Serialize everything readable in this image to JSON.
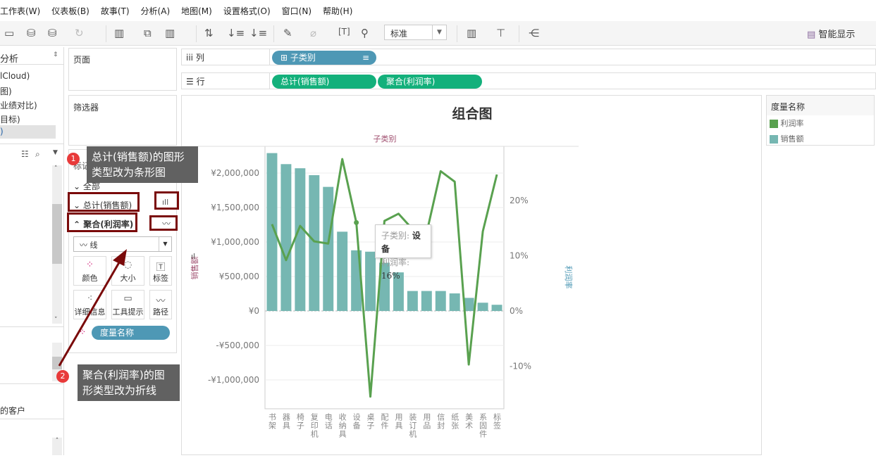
{
  "menu": [
    "工作表(W)",
    "仪表板(B)",
    "故事(T)",
    "分析(A)",
    "地图(M)",
    "设置格式(O)",
    "窗口(N)",
    "帮助(H)"
  ],
  "toolbar": {
    "fit_select": "标准",
    "smart_show": "智能显示"
  },
  "data_pane": {
    "title": "分析",
    "items": [
      "lCloud)",
      "图)",
      "业绩对比)",
      "目标)",
      ")"
    ],
    "set_item": "的客户"
  },
  "shelves": {
    "pages": "页面",
    "filters": "筛选器",
    "columns_label": "列",
    "rows_label": "行",
    "columns": [
      "子类别"
    ],
    "rows": [
      "总计(销售额)",
      "聚合(利润率)"
    ]
  },
  "marks": {
    "title": "标记",
    "all": "全部",
    "sum_sales": "总计(销售额)",
    "agg_profit": "聚合(利润率)",
    "mark_type": "线",
    "cards": [
      "颜色",
      "大小",
      "标签",
      "详细信息",
      "工具提示",
      "路径"
    ],
    "color_pill": "度量名称"
  },
  "legend": {
    "title": "度量名称",
    "items": [
      {
        "label": "利润率",
        "color": "#59a14f"
      },
      {
        "label": "销售额",
        "color": "#76b7b2"
      }
    ]
  },
  "tooltip": {
    "k1": "子类别:",
    "v1": "设备",
    "k2": "利润率:",
    "v2": "16%"
  },
  "annotations": {
    "n1": "1",
    "text1": "总计(销售额)的图形类型改为条形图",
    "n2": "2",
    "text2": "聚合(利润率)的图形类型改为折线"
  },
  "chart_data": {
    "type": "bar+line",
    "title": "组合图",
    "xlabel": "子类别",
    "ylabel": "销售额",
    "y2label": "利润率",
    "categories": [
      "书架",
      "器具",
      "椅子",
      "复印机",
      "电话",
      "收纳具",
      "设备",
      "桌子",
      "配件",
      "用具",
      "装订机",
      "用品",
      "信封",
      "纸张",
      "美术",
      "系固件",
      "标签"
    ],
    "series": [
      {
        "name": "销售额",
        "type": "bar",
        "color": "#76b7b2",
        "values": [
          2290000,
          2130000,
          2070000,
          1970000,
          1800000,
          1150000,
          880000,
          860000,
          700000,
          560000,
          290000,
          290000,
          290000,
          255000,
          190000,
          120000,
          90000
        ]
      },
      {
        "name": "利润率",
        "type": "line",
        "color": "#59a14f",
        "values": [
          15.7,
          9.2,
          15.4,
          12.6,
          12.2,
          27.5,
          16,
          -15.5,
          16.3,
          17.6,
          14.8,
          14.1,
          25.3,
          23.4,
          -9.7,
          14.4,
          24.7
        ]
      }
    ],
    "ylim": [
      -1418000,
      2388000
    ],
    "y2lim": [
      -17.7,
      29.8
    ],
    "yticks": [
      -1000000,
      -500000,
      0,
      500000,
      1000000,
      1500000,
      2000000
    ],
    "ytick_labels": [
      "-¥1,000,000",
      "-¥500,000",
      "¥0",
      "¥500,000",
      "¥1,000,000",
      "¥1,500,000",
      "¥2,000,000"
    ],
    "y2ticks": [
      -10,
      0,
      10,
      20
    ],
    "y2tick_labels": [
      "-10%",
      "0%",
      "10%",
      "20%"
    ]
  }
}
